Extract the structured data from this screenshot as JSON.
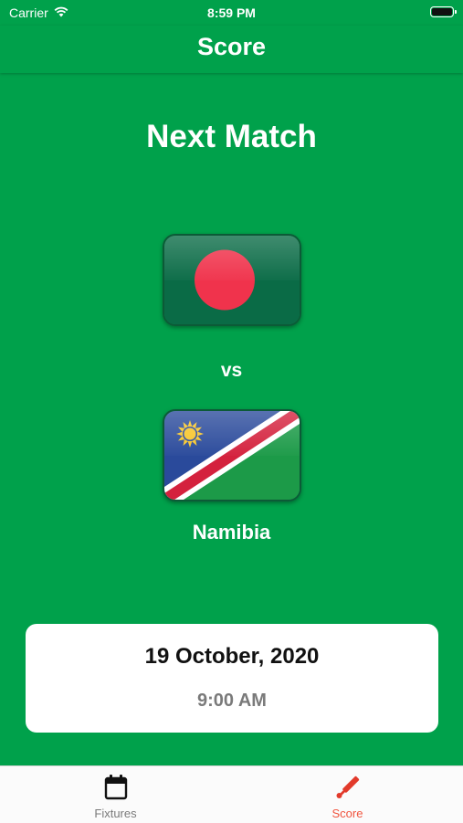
{
  "status_bar": {
    "carrier": "Carrier",
    "time": "8:59 PM",
    "wifi_icon": "wifi-icon",
    "battery_icon": "battery-icon"
  },
  "nav": {
    "title": "Score"
  },
  "match": {
    "heading": "Next Match",
    "team1": {
      "flag": "bangladesh-flag",
      "name": ""
    },
    "versus": "vs",
    "team2": {
      "flag": "namibia-flag",
      "name": "Namibia"
    },
    "date": "19 October, 2020",
    "time": "9:00 AM"
  },
  "tab_bar": {
    "active_color": "#f0553f",
    "inactive_color": "#7a7a7a",
    "tabs": [
      {
        "label": "Fixtures",
        "icon": "calendar-icon",
        "active": false
      },
      {
        "label": "Score",
        "icon": "cricket-bat-icon",
        "active": true
      }
    ]
  },
  "colors": {
    "background": "#00a14b",
    "card": "#ffffff"
  }
}
